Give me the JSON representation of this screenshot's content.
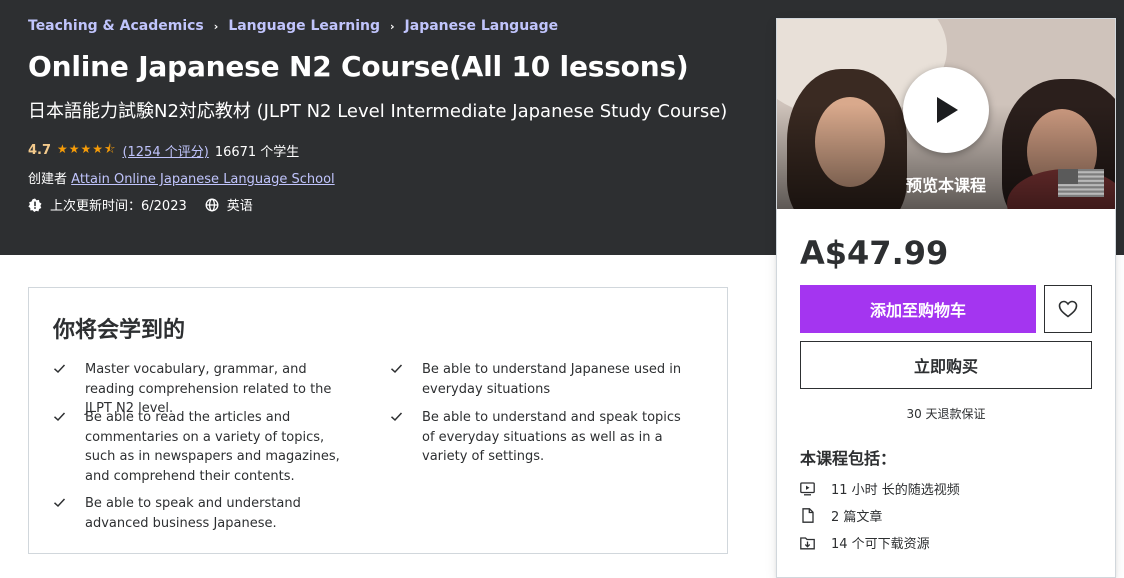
{
  "breadcrumb": {
    "items": [
      "Teaching & Academics",
      "Language Learning",
      "Japanese Language"
    ],
    "separator": "›"
  },
  "course": {
    "title": "Online Japanese N2 Course(All 10 lessons)",
    "subtitle": "日本語能力試験N2対応教材 (JLPT N2 Level Intermediate Japanese Study Course)",
    "rating_value": "4.7",
    "stars": "★★★★⯪",
    "rating_count": "(1254 个评分)",
    "students": "16671 个学生",
    "creator_label": "创建者",
    "creator_name": "Attain Online Japanese Language School",
    "updated_label": "上次更新时间：6/2023",
    "language": "英语"
  },
  "learn": {
    "title": "你将会学到的",
    "items": [
      "Master vocabulary, grammar, and reading comprehension related to the JLPT N2 level.",
      "Be able to understand Japanese used in everyday situations",
      "Be able to read the articles and commentaries on a variety of topics, such as in newspapers and magazines, and comprehend their contents.",
      "Be able to understand and speak topics of everyday situations as well as in a variety of settings.",
      "Be able to speak and understand advanced business Japanese."
    ]
  },
  "card": {
    "preview_label": "预览本课程",
    "price": "A$47.99",
    "add_to_cart": "添加至购物车",
    "buy_now": "立即购买",
    "guarantee": "30 天退款保证",
    "includes_title": "本课程包括：",
    "includes": [
      {
        "icon": "video-icon",
        "label": "11 小时 长的随选视频"
      },
      {
        "icon": "file-icon",
        "label": "2 篇文章"
      },
      {
        "icon": "download-icon",
        "label": "14 个可下载资源"
      }
    ]
  },
  "colors": {
    "hero_bg": "#2d2f31",
    "link": "#c0c4fc",
    "rating": "#f3ca8c",
    "star": "#f69c08",
    "primary_button": "#a435f0"
  }
}
